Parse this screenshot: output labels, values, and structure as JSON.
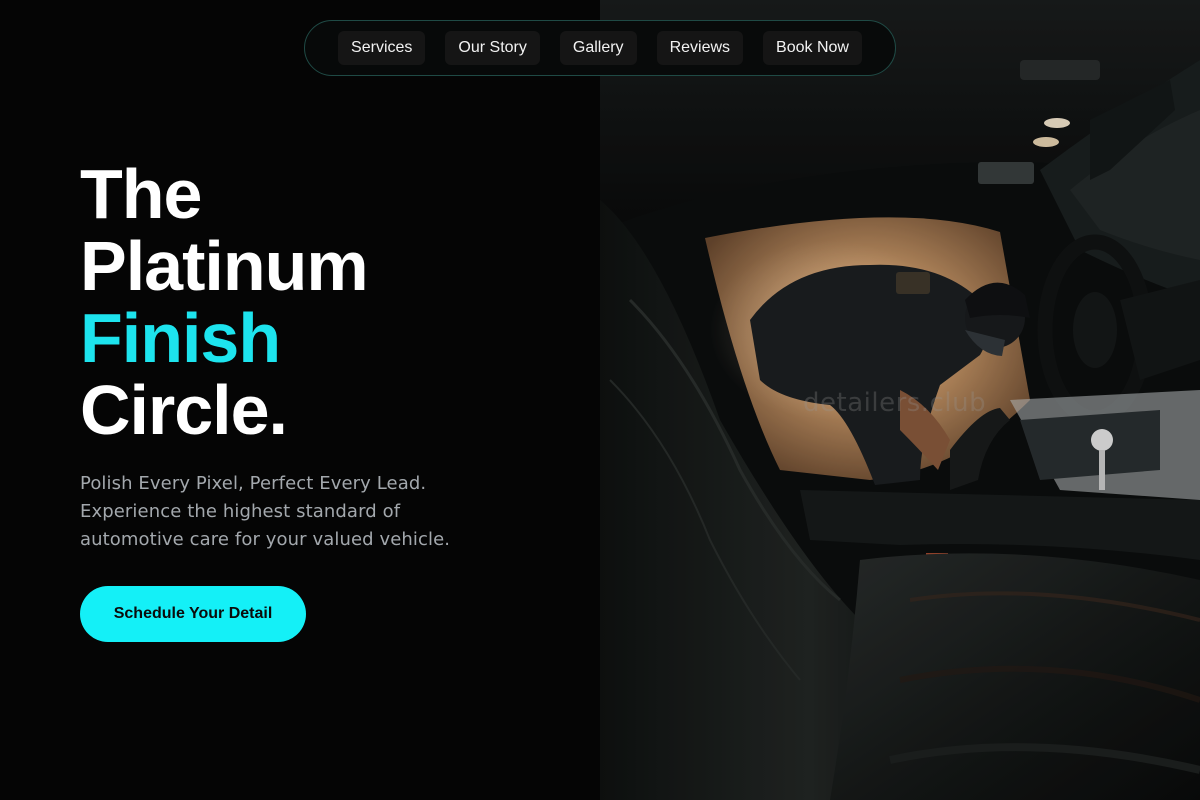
{
  "nav": {
    "items": [
      {
        "label": "Services"
      },
      {
        "label": "Our Story"
      },
      {
        "label": "Gallery"
      },
      {
        "label": "Reviews"
      },
      {
        "label": "Book Now"
      }
    ]
  },
  "hero": {
    "title_line_1": "The",
    "title_line_2": "Platinum",
    "title_line_3": "Finish",
    "title_line_4": "Circle.",
    "subtitle_line_1": "Polish Every Pixel, Perfect Every Lead.",
    "subtitle_line_2": "Experience the highest standard of",
    "subtitle_line_3": "automotive care for your valued vehicle.",
    "cta_label": "Schedule Your Detail"
  },
  "photo": {
    "watermark": "detailers.club",
    "subject": "detailer-cleaning-car-interior"
  },
  "colors": {
    "accent": "#1de4ee",
    "cta_background": "#14f0f7",
    "background": "#050505",
    "nav_border": "#1f4a45"
  }
}
